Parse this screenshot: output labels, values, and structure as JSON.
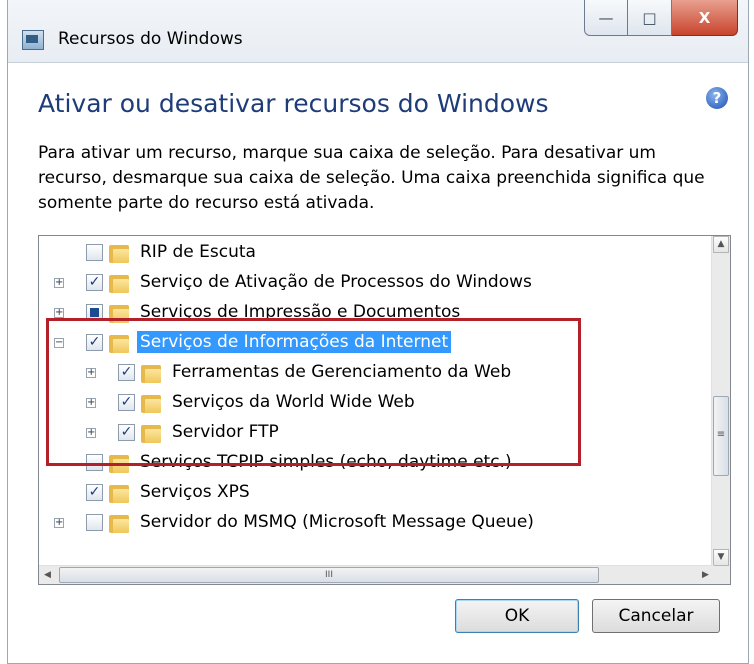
{
  "window": {
    "title": "Recursos do Windows",
    "caption": {
      "minimize": "—",
      "maximize": "□",
      "close": "X"
    }
  },
  "heading": "Ativar ou desativar recursos do Windows",
  "help_icon": "?",
  "description": "Para ativar um recurso, marque sua caixa de seleção. Para desativar um recurso, desmarque sua caixa de seleção. Uma caixa preenchida significa que somente parte do recurso está ativada.",
  "tree": {
    "items": [
      {
        "label": "RIP de Escuta",
        "level": 0,
        "expander": "",
        "state": "unchecked",
        "selected": false
      },
      {
        "label": "Serviço de Ativação de Processos do Windows",
        "level": 0,
        "expander": "+",
        "state": "checked",
        "selected": false
      },
      {
        "label": "Serviços de Impressão e Documentos",
        "level": 0,
        "expander": "+",
        "state": "partial",
        "selected": false
      },
      {
        "label": "Serviços de Informações da Internet",
        "level": 0,
        "expander": "−",
        "state": "checked",
        "selected": true
      },
      {
        "label": "Ferramentas de Gerenciamento da Web",
        "level": 1,
        "expander": "+",
        "state": "checked",
        "selected": false
      },
      {
        "label": "Serviços da World Wide Web",
        "level": 1,
        "expander": "+",
        "state": "checked",
        "selected": false
      },
      {
        "label": "Servidor FTP",
        "level": 1,
        "expander": "+",
        "state": "checked",
        "selected": false
      },
      {
        "label": "Serviços TCPIP simples (echo, daytime etc.)",
        "level": 0,
        "expander": "",
        "state": "unchecked",
        "selected": false
      },
      {
        "label": "Serviços XPS",
        "level": 0,
        "expander": "",
        "state": "checked",
        "selected": false
      },
      {
        "label": "Servidor do MSMQ (Microsoft Message Queue)",
        "level": 0,
        "expander": "+",
        "state": "unchecked",
        "selected": false
      }
    ],
    "hscroll_grip": "III",
    "vscroll_grip": "≡"
  },
  "buttons": {
    "ok": "OK",
    "cancel": "Cancelar"
  },
  "colors": {
    "heading": "#1e3c78",
    "selection": "#3399ff",
    "highlight": "#b3202a"
  },
  "icons": [
    "app-icon",
    "help-icon",
    "folder-icon",
    "checkbox",
    "expander-icon"
  ]
}
